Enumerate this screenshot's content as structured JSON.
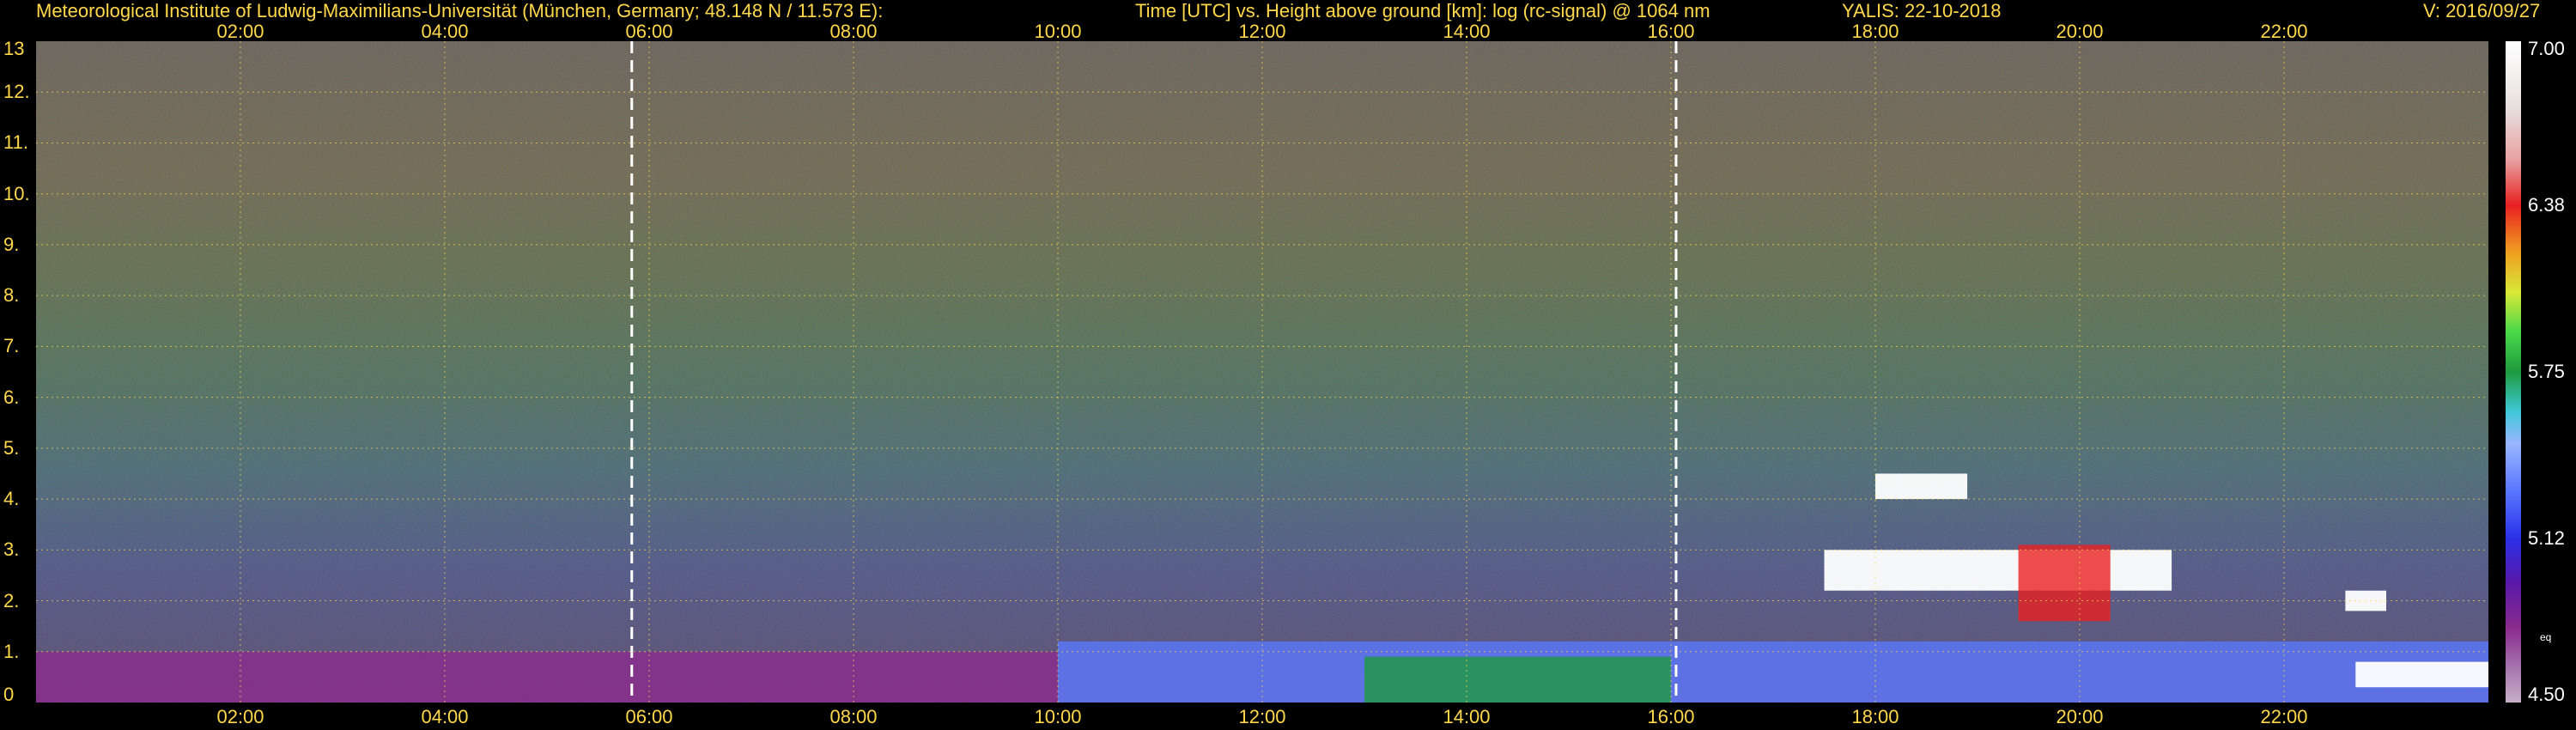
{
  "header": {
    "institute": "Meteorological Institute of Ludwig-Maximilians-Universität (München, Germany; 48.148 N / 11.573 E):",
    "plot_desc": "Time [UTC] vs. Height above ground [km]: log (rc-signal) @ 1064 nm",
    "station_date": "YALIS: 22-10-2018",
    "version": "V: 2016/09/27"
  },
  "colors": {
    "text": "#ffd84a",
    "text_secondary": "#ffffff",
    "background": "#000000",
    "gridlines": "#ffd84a",
    "marker_lines": "#ffffff"
  },
  "chart_data": {
    "type": "heatmap",
    "title": "Time [UTC] vs. Height above ground [km]: log (rc-signal) @ 1064 nm",
    "xlabel": "Time [UTC]",
    "ylabel": "Height above ground [km]",
    "x_ticks_top": [
      "02:00",
      "04:00",
      "06:00",
      "08:00",
      "10:00",
      "12:00",
      "14:00",
      "16:00",
      "18:00",
      "20:00",
      "22:00"
    ],
    "x_ticks_bottom": [
      "02:00",
      "04:00",
      "06:00",
      "08:00",
      "10:00",
      "12:00",
      "14:00",
      "16:00",
      "18:00",
      "20:00",
      "22:00"
    ],
    "x_tick_hours": [
      2,
      4,
      6,
      8,
      10,
      12,
      14,
      16,
      18,
      20,
      22
    ],
    "xlim_hours": [
      0,
      24
    ],
    "y_ticks": [
      "0",
      "1.",
      "2.",
      "3.",
      "4.",
      "5.",
      "6.",
      "7.",
      "8.",
      "9.",
      "10.",
      "11.",
      "12.",
      "13"
    ],
    "y_tick_km": [
      0,
      1,
      2,
      3,
      4,
      5,
      6,
      7,
      8,
      9,
      10,
      11,
      12,
      13
    ],
    "ylim_km": [
      0,
      13
    ],
    "grid": true,
    "vertical_markers_hours": [
      5.83,
      16.05
    ],
    "colorbar": {
      "range": [
        4.5,
        7.0
      ],
      "tick_labels": [
        "7.00",
        "6.38",
        "5.75",
        "5.12",
        "4.50"
      ],
      "tick_values": [
        7.0,
        6.38,
        5.75,
        5.12,
        4.5
      ],
      "unit_label": "eq",
      "stops": [
        {
          "value": 4.5,
          "color": "#c8b0c8"
        },
        {
          "value": 4.62,
          "color": "#a87ab0"
        },
        {
          "value": 4.78,
          "color": "#8a2c8e"
        },
        {
          "value": 4.95,
          "color": "#5a18a8"
        },
        {
          "value": 5.12,
          "color": "#2a30e8"
        },
        {
          "value": 5.3,
          "color": "#5a78ff"
        },
        {
          "value": 5.48,
          "color": "#9ab6ff"
        },
        {
          "value": 5.6,
          "color": "#3ec8d8"
        },
        {
          "value": 5.75,
          "color": "#1e9a3e"
        },
        {
          "value": 5.9,
          "color": "#48d848"
        },
        {
          "value": 6.05,
          "color": "#d8e838"
        },
        {
          "value": 6.2,
          "color": "#f0a020"
        },
        {
          "value": 6.38,
          "color": "#e82020"
        },
        {
          "value": 6.55,
          "color": "#e8a0a0"
        },
        {
          "value": 6.75,
          "color": "#e8e0e0"
        },
        {
          "value": 7.0,
          "color": "#ffffff"
        }
      ]
    },
    "features": [
      {
        "name": "boundary layer",
        "start_h": 0.0,
        "end_h": 10.0,
        "top_km": 1.0,
        "value": 4.85
      },
      {
        "name": "boundary layer",
        "start_h": 10.0,
        "end_h": 24.0,
        "top_km": 1.2,
        "value": 5.45
      },
      {
        "name": "aerosol layer",
        "start_h": 13.0,
        "end_h": 16.0,
        "top_km": 0.9,
        "value": 5.8
      },
      {
        "name": "cloud",
        "start_h": 17.5,
        "end_h": 20.9,
        "base_km": 2.2,
        "top_km": 3.0,
        "value": 7.0
      },
      {
        "name": "cloud",
        "start_h": 18.0,
        "end_h": 18.9,
        "base_km": 4.0,
        "top_km": 4.5,
        "value": 7.0
      },
      {
        "name": "cloud",
        "start_h": 19.4,
        "end_h": 20.3,
        "base_km": 1.6,
        "top_km": 3.1,
        "value": 6.4
      },
      {
        "name": "cloud",
        "start_h": 22.6,
        "end_h": 23.0,
        "base_km": 1.8,
        "top_km": 2.2,
        "value": 7.0
      },
      {
        "name": "low cloud",
        "start_h": 22.7,
        "end_h": 24.0,
        "base_km": 0.3,
        "top_km": 0.8,
        "value": 7.0
      }
    ]
  }
}
